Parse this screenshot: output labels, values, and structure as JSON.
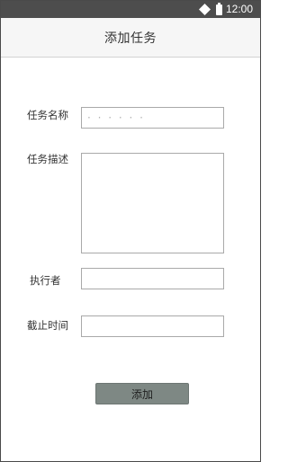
{
  "status_bar": {
    "time": "12:00",
    "icons": [
      "wifi-icon",
      "battery-icon"
    ],
    "background": "#4d4d4d"
  },
  "header": {
    "title": "添加任务"
  },
  "form": {
    "task_name": {
      "label": "任务名称",
      "placeholder": "· · · · · ·",
      "value": ""
    },
    "task_description": {
      "label": "任务描述",
      "value": ""
    },
    "assignee": {
      "label": "执行者",
      "value": ""
    },
    "deadline": {
      "label": "截止时间",
      "value": ""
    }
  },
  "actions": {
    "add_label": "添加",
    "add_color": "#7e8884"
  }
}
